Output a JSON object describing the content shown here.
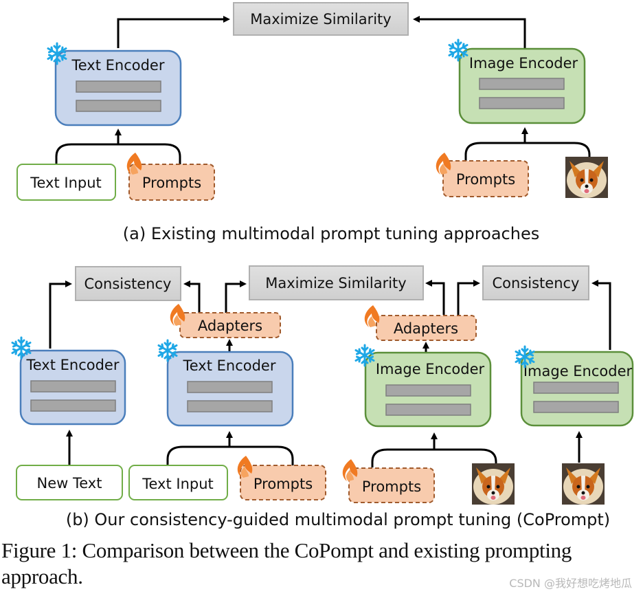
{
  "panel_a": {
    "caption": "(a) Existing multimodal prompt tuning approaches",
    "objective": "Maximize Similarity",
    "text_encoder": "Text Encoder",
    "image_encoder": "Image Encoder",
    "text_input": "Text Input",
    "text_prompts": "Prompts",
    "image_prompts": "Prompts",
    "image_label": "dog-image"
  },
  "panel_b": {
    "caption": "(b) Our consistency-guided multimodal prompt tuning (CoPrompt)",
    "consistency_left": "Consistency",
    "objective": "Maximize Similarity",
    "consistency_right": "Consistency",
    "adapters_text": "Adapters",
    "adapters_image": "Adapters",
    "text_encoder_frozen": "Text Encoder",
    "text_encoder_tuned": "Text Encoder",
    "image_encoder_tuned": "Image Encoder",
    "image_encoder_frozen": "Image Encoder",
    "new_text": "New Text",
    "text_input": "Text Input",
    "text_prompts": "Prompts",
    "image_prompts": "Prompts"
  },
  "figure_caption": {
    "line1": "Figure 1: Comparison between the CoPompt and existing prompting",
    "line2": "approach."
  },
  "watermark": "CSDN @我好想吃烤地瓜",
  "colors": {
    "text_encoder_fill": "#c9d6ec",
    "text_encoder_stroke": "#4a7ebb",
    "image_encoder_fill": "#c6e0b4",
    "image_encoder_stroke": "#5b8f3a",
    "prompt_fill": "#f8cbad",
    "prompt_stroke": "#a05a2c",
    "objective_fill": "#d6d6d6",
    "layer_fill": "#a6a6a6",
    "input_stroke": "#70ad47",
    "snowflake": "#1ea7e6",
    "flame": "#f07a22"
  }
}
